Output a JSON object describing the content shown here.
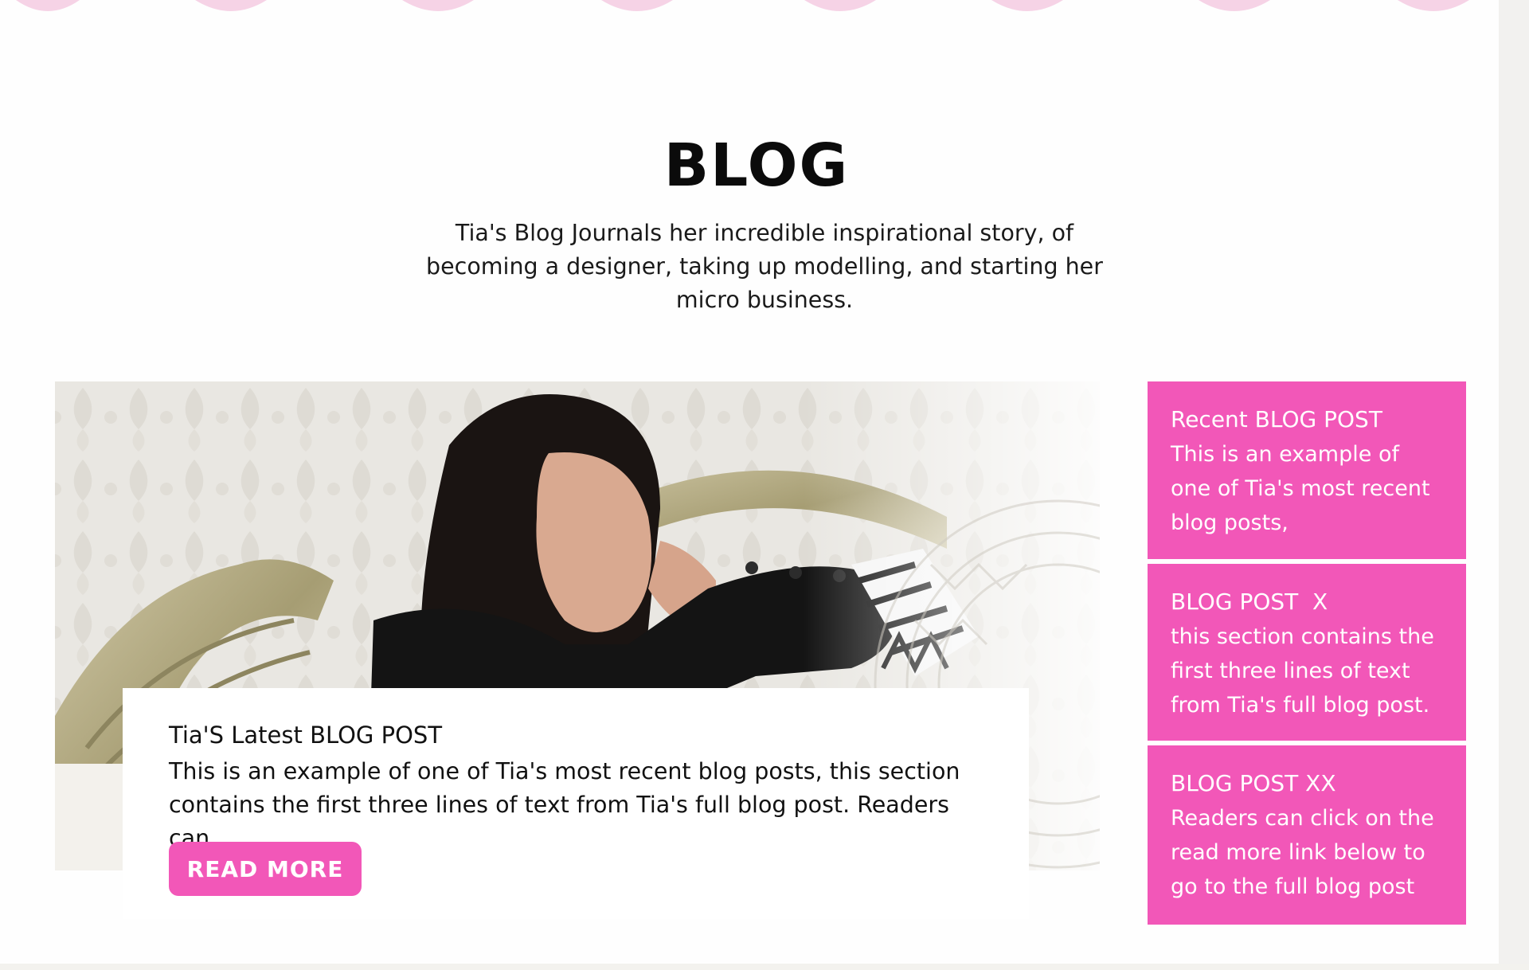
{
  "blog": {
    "title": "BLOG",
    "intro": "Tia's Blog Journals her incredible inspirational story, of becoming a designer, taking up modelling, and starting her micro business."
  },
  "featured_post": {
    "title": "Tia'S Latest BLOG POST",
    "excerpt": "This is an example of one of Tia's most recent blog posts, this section contains the first three lines of text from Tia's full blog post. Readers can",
    "button_label": "READ MORE"
  },
  "sidebar": {
    "items": [
      {
        "title": "Recent BLOG POST",
        "text": "This is an example of one of Tia's most recent blog posts,"
      },
      {
        "title": "BLOG POST  X",
        "text": "this section contains the first three lines of text from Tia's full blog post."
      },
      {
        "title": "BLOG POST XX",
        "text": "Readers can click on the read more link below to go to the full blog post"
      }
    ]
  },
  "colors": {
    "accent_pink": "#f257b8",
    "text_dark": "#111111",
    "background": "#fefefe"
  }
}
